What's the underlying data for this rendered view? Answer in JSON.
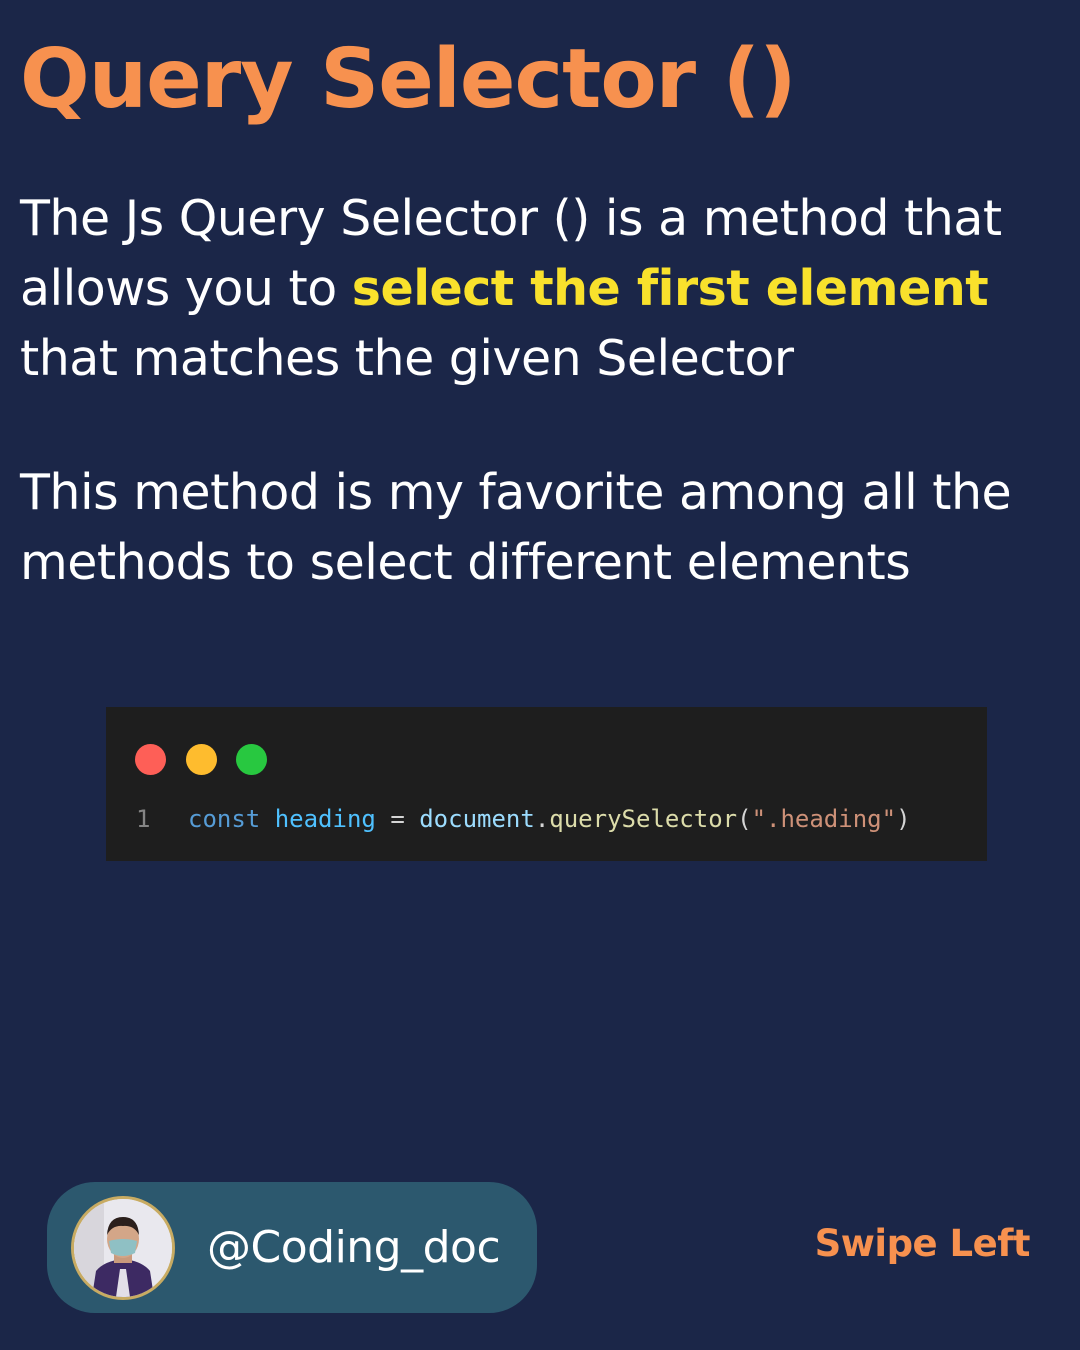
{
  "title": "Query Selector ()",
  "paragraph1": {
    "before": "The Js Query Selector () is a method that allows you to ",
    "highlight": "select the first element",
    "after": " that matches the given Selector"
  },
  "paragraph2": "This method is my favorite among all the methods to select different elements",
  "code_window": {
    "dots": [
      "red-dot",
      "yellow-dot",
      "green-dot"
    ],
    "line_number": "1",
    "tokens": {
      "keyword": "const",
      "variable": "heading",
      "operator": "=",
      "object": "document",
      "dot": ".",
      "method": "querySelector",
      "open_paren": "(",
      "string": "\".heading\"",
      "close_paren": ")"
    }
  },
  "author": {
    "handle": "@Coding_doc",
    "avatar": "avatar-photo-icon"
  },
  "swipe_label": "Swipe Left",
  "colors": {
    "background": "#1b2648",
    "accent_orange": "#f7914f",
    "highlight_yellow": "#f9e12c",
    "pill": "#2c586e"
  }
}
